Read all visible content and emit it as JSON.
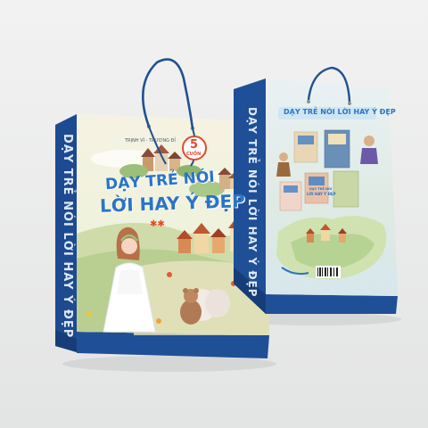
{
  "front_bag": {
    "authors": "TRỊNH VĨ - TRƯƠNG ĐỈ",
    "badge_number": "5",
    "badge_unit": "CUỐN",
    "title_line1": "DẠY TRẺ NÓI",
    "title_line2": "LỜI HAY Ý ĐẸP",
    "stars": "✱✱",
    "side_text": "DẠY TRẺ NÓI LỜI HAY Ý ĐẸP"
  },
  "back_bag": {
    "header": "DẠY TRẺ NÓI LỜI HAY Ý ĐẸP",
    "side_text": "DẠY TRẺ NÓI LỜI HAY Ý ĐẸP",
    "mini_title_line1": "DẠY TRẺ NÓI",
    "mini_title_line2": "LỜI HAY Ý ĐẸP"
  },
  "colors": {
    "bag_blue": "#1f4f97",
    "bag_blue_dark": "#173f7c",
    "cover_bg": "#eef2dd",
    "title_blue": "#2a74c7",
    "badge_red": "#e24a2a",
    "background": "#eceded"
  }
}
